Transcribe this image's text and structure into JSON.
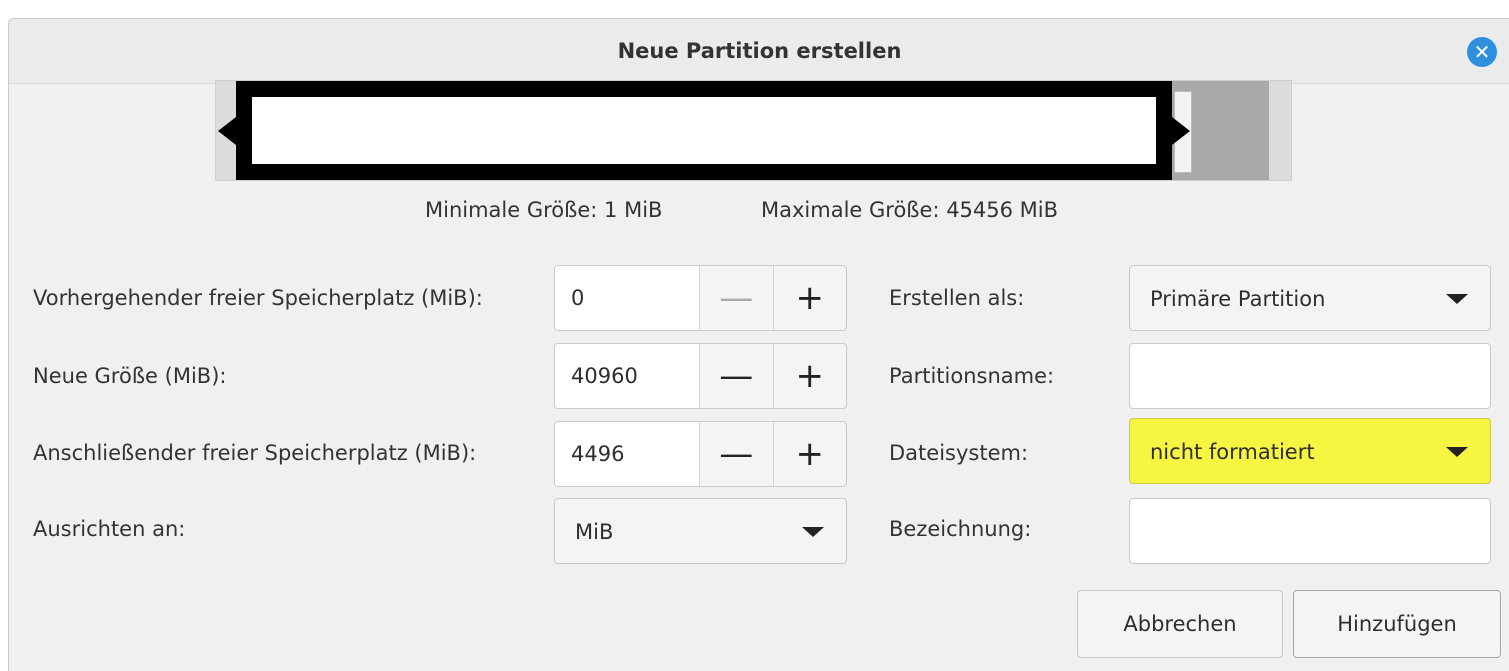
{
  "dialog": {
    "title": "Neue Partition erstellen",
    "close_icon": "close-icon",
    "accent_color": "#2f8fdd",
    "highlight_color": "#f5f542"
  },
  "size_info": {
    "min": "Minimale Größe: 1 MiB",
    "max": "Maximale Größe: 45456 MiB"
  },
  "fields": {
    "preceding_label": "Vorhergehender freier Speicherplatz (MiB):",
    "preceding_value": "0",
    "new_size_label": "Neue Größe (MiB):",
    "new_size_value": "40960",
    "following_label": "Anschließender freier Speicherplatz (MiB):",
    "following_value": "4496",
    "align_label": "Ausrichten an:",
    "align_value": "MiB",
    "create_as_label": "Erstellen als:",
    "create_as_value": "Primäre Partition",
    "partition_name_label": "Partitionsname:",
    "partition_name_value": "",
    "filesystem_label": "Dateisystem:",
    "filesystem_value": "nicht formatiert",
    "label_label": "Bezeichnung:",
    "label_value": ""
  },
  "spin": {
    "minus": "—",
    "plus": "+"
  },
  "buttons": {
    "cancel": "Abbrechen",
    "add": "Hinzufügen"
  }
}
